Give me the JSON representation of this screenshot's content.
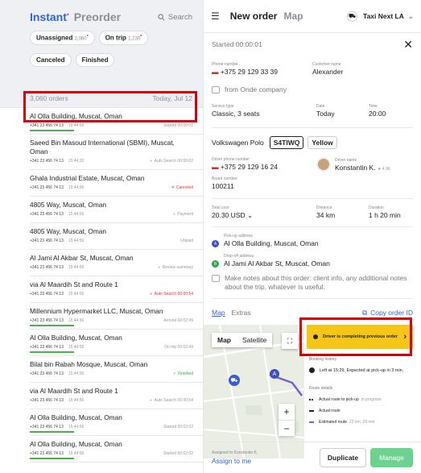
{
  "left": {
    "tab_active": "Instant",
    "tab_other": "Preorder",
    "search_label": "Search",
    "chips": [
      {
        "label": "Unassigned",
        "count": "2,060",
        "dot": true
      },
      {
        "label": "On trip",
        "count": "1,230",
        "dot": true
      },
      {
        "label": "Canceled",
        "count": "",
        "dot": false
      },
      {
        "label": "Finished",
        "count": "",
        "dot": false
      }
    ],
    "orders_count": "3,060 orders",
    "date": "Today, Jul 12",
    "orders": [
      {
        "title": "Al Olla Building, Muscat, Oman",
        "phone": "+341 23 456 74 13",
        "time": "15:44:56",
        "status": "Started 00:00:01",
        "status_color": "gray",
        "progress": true
      },
      {
        "title": "Saeed Bin Masoud International (SBMI), Muscat, Oman",
        "phone": "+341 23 456 74 13",
        "time": "15:44:20",
        "status": "Auto Search 00:00:02",
        "status_color": "gray",
        "progress": false,
        "tall": true,
        "icon": "spinner-icon"
      },
      {
        "title": "Ghala Industrial Estate, Muscat, Oman",
        "phone": "+341 23 456 74 13",
        "time": "15:44:56",
        "status": "Canceled",
        "status_color": "red",
        "progress": false,
        "icon": "x-icon"
      },
      {
        "title": "4805 Way, Muscat, Oman",
        "phone": "+341 23 456 74 13",
        "time": "15:44:56",
        "status": "Payment",
        "status_color": "gray",
        "progress": false,
        "icon": "spinner-icon"
      },
      {
        "title": "4805 Way, Muscat, Oman",
        "phone": "+341 23 456 74 13",
        "time": "15:44:56",
        "status": "Unpaid",
        "status_color": "gray",
        "progress": false
      },
      {
        "title": "Al Jami Al Akbar St, Muscat, Oman",
        "phone": "+341 23 456 74 13",
        "time": "15:44:56",
        "status": "Review summary",
        "status_color": "gray",
        "progress": false,
        "icon": "spinner-icon"
      },
      {
        "title": "via Al Maardih St and Route 1",
        "phone": "+341 23 456 74 13",
        "time": "15:44:56",
        "status": "Auto Search 00:00:54",
        "status_color": "red",
        "progress": false,
        "icon": "spinner-icon"
      },
      {
        "title": "Millennium Hypermarket LLC, Muscat, Oman",
        "phone": "+341 23 456 74 13",
        "time": "15:44:56",
        "status": "Arrived 00:02:49",
        "status_color": "gray",
        "progress": true
      },
      {
        "title": "Al Olla Building, Muscat, Oman",
        "phone": "+341 23 456 74 13",
        "time": "15:44:56",
        "status": "On trip 00:02:49",
        "status_color": "gray",
        "progress": true
      },
      {
        "title": "Bilal bin Rabah Mosque, Muscat, Oman",
        "phone": "+341 23 456 74 13",
        "time": "15:44:56",
        "status": "Finished",
        "status_color": "green",
        "progress": false,
        "icon": "check-icon"
      },
      {
        "title": "via Al Maardih St and Route 1",
        "phone": "+341 23 456 74 13",
        "time": "15:44:56",
        "status": "Auto Search 00:00:54",
        "status_color": "gray",
        "progress": false,
        "icon": "spinner-icon"
      },
      {
        "title": "Al Olla Building, Muscat, Oman",
        "phone": "+341 23 456 74 13",
        "time": "15:44:56",
        "status": "Started 00:02:02",
        "status_color": "gray",
        "progress": true
      },
      {
        "title": "Al Olla Building, Muscat, Oman",
        "phone": "+341 23 456 74 13",
        "time": "15:44:56",
        "status": "Started 00:02:02",
        "status_color": "gray",
        "progress": true
      }
    ]
  },
  "right": {
    "title": "New order",
    "title2": "Map",
    "app_name": "Taxi Next LA",
    "started": "Started 00:00:01",
    "phone_label": "Phone number",
    "phone": "+375 29 129 33 39",
    "customer_label": "Customer name",
    "customer": "Alexander",
    "from_company": "from Onde company",
    "service_label": "Service type",
    "service": "Classic, 3 seats",
    "date_label": "Date",
    "date": "Today",
    "time_label": "Time",
    "time": "20:00",
    "car_model": "Volkswagen Polo",
    "plate": "S4TIWQ",
    "car_color": "Yellow",
    "driver_phone_label": "Driver phone number",
    "driver_phone": "+375 29 129 16 24",
    "driver_name_label": "Driver name",
    "driver_name": "Konstantin K.",
    "driver_rating": "★ 4.96",
    "board_label": "Board number",
    "board": "100211",
    "cost_label": "Total cost",
    "cost": "20.30 USD",
    "distance_label": "Distance",
    "distance": "34 km",
    "duration_label": "Duration",
    "duration": "1 h 20 min",
    "pickup_label": "Pick-up address",
    "pickup": "Al Olla Building, Muscat, Oman",
    "dropoff_label": "Drop-off address",
    "dropoff": "Al Jami Al Akbar St, Muscat, Oman",
    "note": "Make notes about this order: client info, any additional notes about the trip, whatever is useful.",
    "tab_map": "Map",
    "tab_extras": "Extras",
    "copy_id": "Copy order ID",
    "map_btn": "Map",
    "sat_btn": "Satellite",
    "status_text": "Driver is completing previous order",
    "booking_history": "Booking history",
    "history_item": "Left at 15:29. Expected at pick-up in 3 min.",
    "route_details": "Route details",
    "route1": "Actual route to pick-up",
    "route1_g": "in progress",
    "route2": "Actual route",
    "route3": "Estimated route",
    "route3_g": "22 km, 29 min",
    "assigned": "Assigned to Konstantin K.",
    "assign_me": "Assign to me",
    "duplicate": "Duplicate",
    "manage": "Manage",
    "accent": "#2f66c9",
    "status_bg": "#f5c518",
    "manage_bg": "#6dd28f"
  }
}
